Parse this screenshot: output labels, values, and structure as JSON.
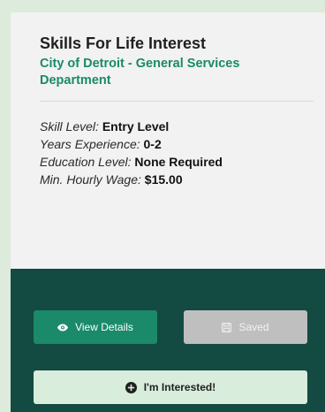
{
  "card": {
    "title": "Skills For Life Interest",
    "employer": "City of Detroit - General Services Department",
    "details": [
      {
        "label": "Skill Level:",
        "value": "Entry Level"
      },
      {
        "label": "Years Experience:",
        "value": "0-2"
      },
      {
        "label": "Education Level:",
        "value": "None Required"
      },
      {
        "label": "Min. Hourly Wage:",
        "value": "$15.00"
      }
    ]
  },
  "actions": {
    "view_details_label": "View Details",
    "view_details_icon": "eye-icon",
    "saved_label": "Saved",
    "saved_icon": "save-icon",
    "interested_label": "I'm Interested!",
    "interested_icon": "plus-circle-icon"
  },
  "colors": {
    "page_background": "#dcebdc",
    "card_background": "#f2f2f2",
    "footer_background": "#134a42",
    "accent_green": "#1a8a6a",
    "saved_disabled": "#bfbfbf",
    "interested_background": "#d8eddc"
  }
}
